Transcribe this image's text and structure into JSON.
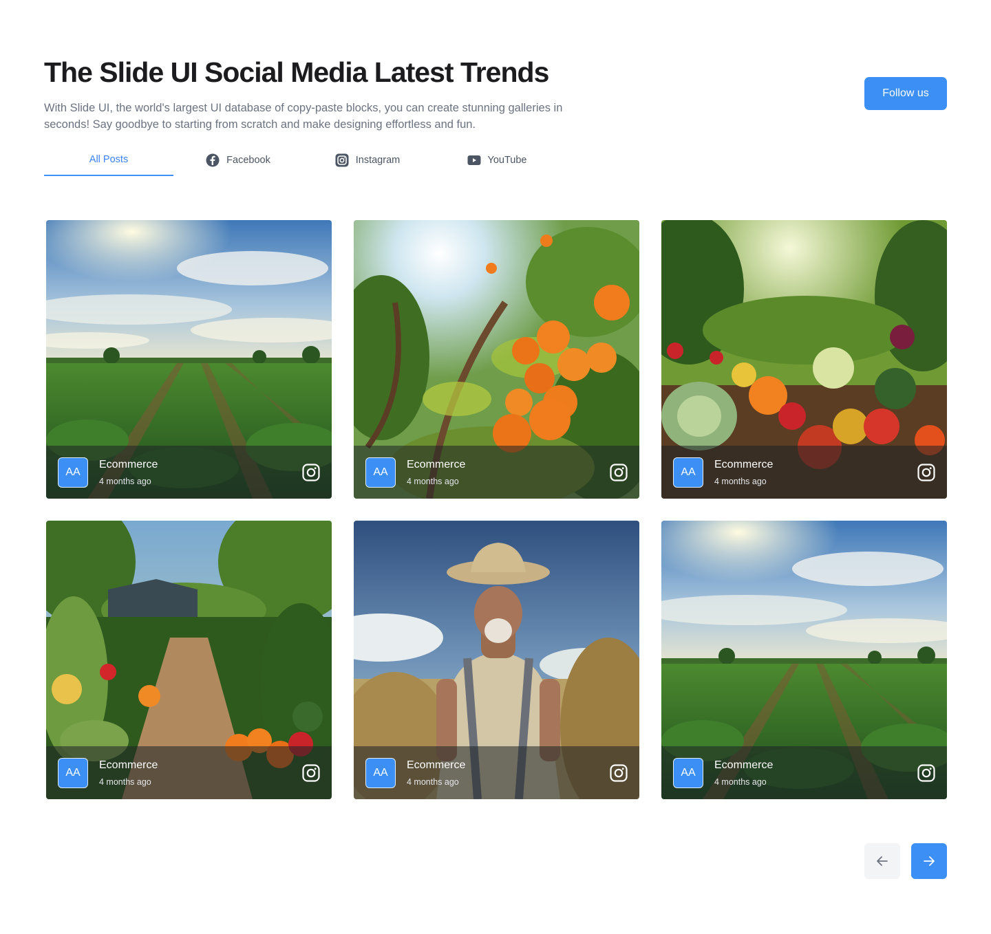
{
  "header": {
    "title": "The Slide UI Social Media Latest Trends",
    "description": "With Slide UI, the world's largest UI database of copy-paste blocks, you can create stunning galleries in seconds! Say goodbye to starting from scratch and make designing effortless and fun.",
    "follow_label": "Follow us"
  },
  "tabs": [
    {
      "label": "All Posts",
      "icon": "",
      "active": true
    },
    {
      "label": "Facebook",
      "icon": "facebook-icon",
      "active": false
    },
    {
      "label": "Instagram",
      "icon": "instagram-icon",
      "active": false
    },
    {
      "label": "YouTube",
      "icon": "youtube-icon",
      "active": false
    }
  ],
  "posts": [
    {
      "author": "Ecommerce",
      "initials": "AA",
      "time": "4 months ago",
      "image": "farm-field-landscape",
      "platform_icon": "instagram-icon"
    },
    {
      "author": "Ecommerce",
      "initials": "AA",
      "time": "4 months ago",
      "image": "orange-tree",
      "platform_icon": "instagram-icon"
    },
    {
      "author": "Ecommerce",
      "initials": "AA",
      "time": "4 months ago",
      "image": "vegetable-harvest",
      "platform_icon": "instagram-icon"
    },
    {
      "author": "Ecommerce",
      "initials": "AA",
      "time": "4 months ago",
      "image": "garden-path",
      "platform_icon": "instagram-icon"
    },
    {
      "author": "Ecommerce",
      "initials": "AA",
      "time": "4 months ago",
      "image": "farmer-portrait",
      "platform_icon": "instagram-icon"
    },
    {
      "author": "Ecommerce",
      "initials": "AA",
      "time": "4 months ago",
      "image": "farm-field-landscape",
      "platform_icon": "instagram-icon"
    }
  ],
  "pagination": {
    "prev_icon": "arrow-left-icon",
    "next_icon": "arrow-right-icon"
  },
  "colors": {
    "accent": "#3b8ff5",
    "active_tab": "#3b82f6",
    "muted_text": "#6b7280"
  }
}
